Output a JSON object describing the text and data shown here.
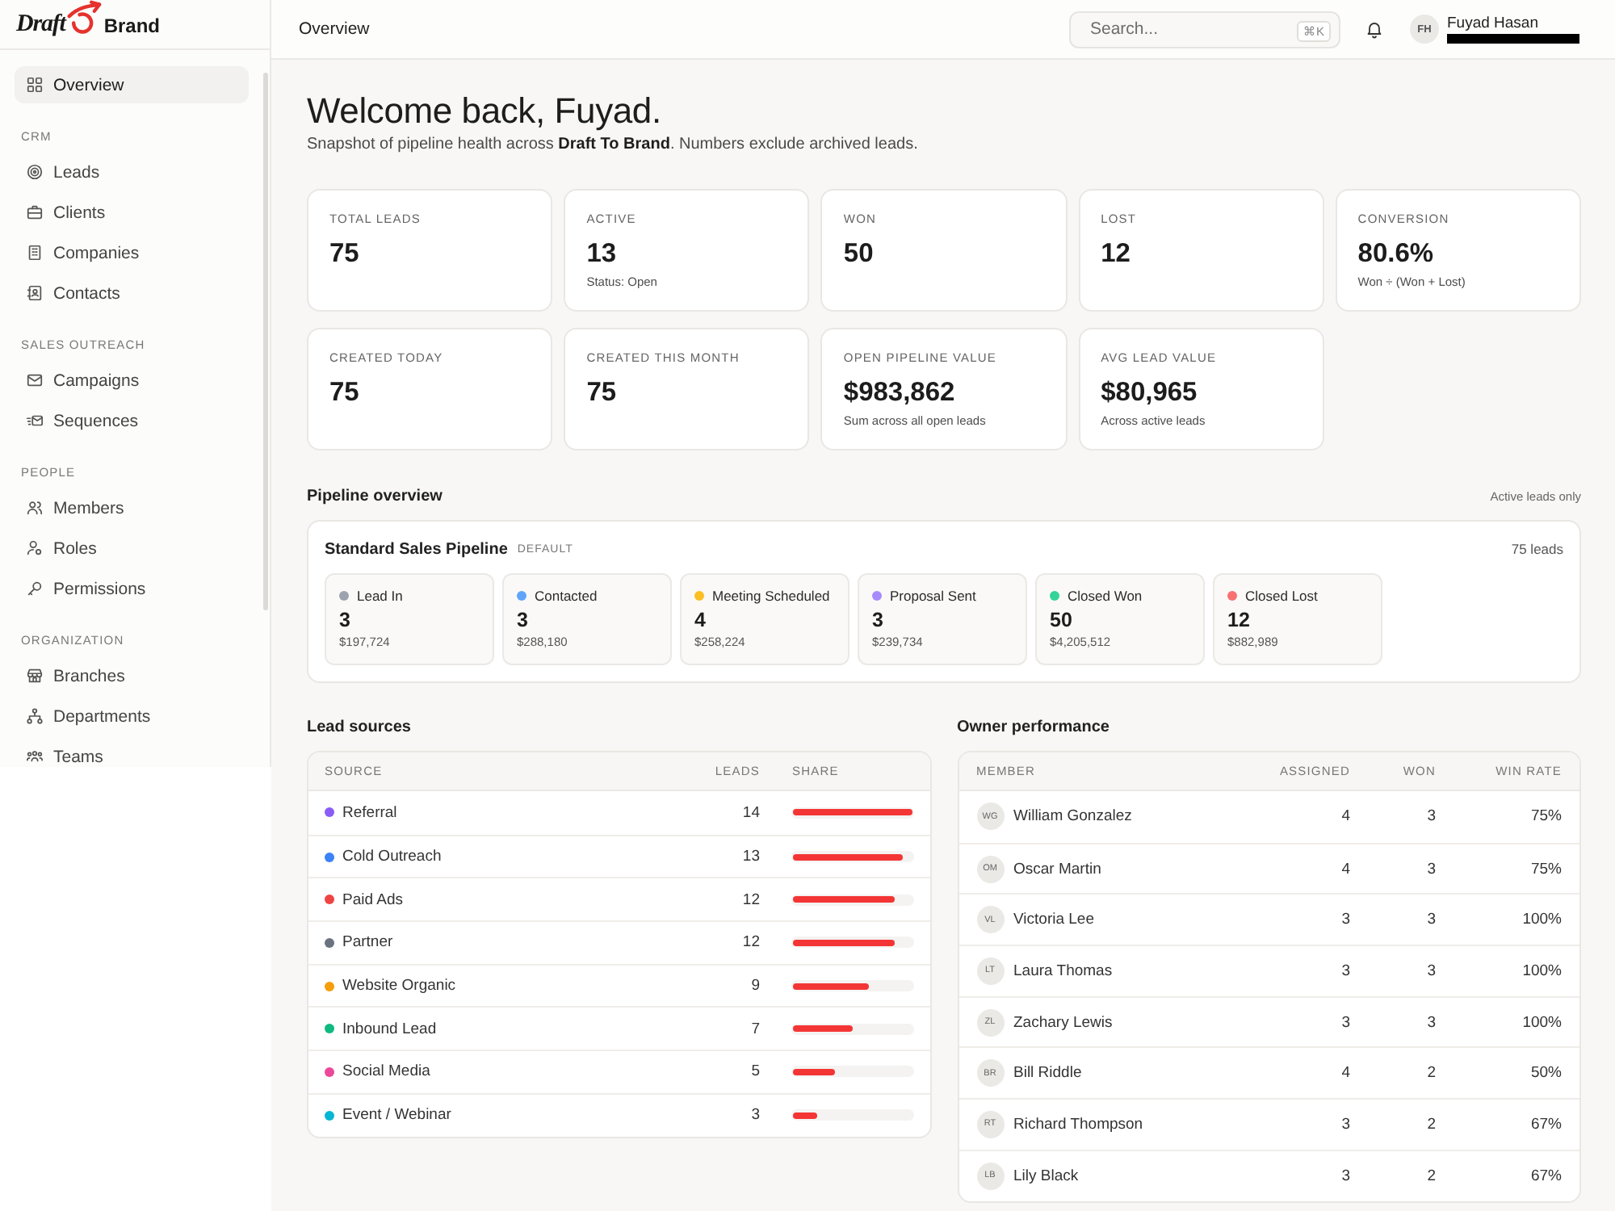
{
  "logo": {
    "word_left": "Draft",
    "word_right": "Brand"
  },
  "sidebar": {
    "sections": [
      {
        "items": [
          {
            "label": "Overview",
            "selected": true
          }
        ]
      },
      {
        "label": "CRM",
        "items": [
          {
            "label": "Leads",
            "selected": false
          },
          {
            "label": "Clients",
            "selected": false
          },
          {
            "label": "Companies",
            "selected": false
          },
          {
            "label": "Contacts",
            "selected": false
          }
        ]
      },
      {
        "label": "SALES OUTREACH",
        "items": [
          {
            "label": "Campaigns",
            "selected": false
          },
          {
            "label": "Sequences",
            "selected": false
          }
        ]
      },
      {
        "label": "PEOPLE",
        "items": [
          {
            "label": "Members",
            "selected": false
          },
          {
            "label": "Roles",
            "selected": false
          },
          {
            "label": "Permissions",
            "selected": false
          }
        ]
      },
      {
        "label": "ORGANIZATION",
        "items": [
          {
            "label": "Branches",
            "selected": false
          },
          {
            "label": "Departments",
            "selected": false
          },
          {
            "label": "Teams",
            "selected": false
          }
        ]
      }
    ]
  },
  "topbar": {
    "title": "Overview",
    "search": {
      "placeholder": "Search...",
      "shortcut": "⌘K"
    },
    "user": {
      "initials": "FH",
      "name": "Fuyad Hasan"
    }
  },
  "welcome": {
    "title": "Welcome back, Fuyad.",
    "subtitle": "Snapshot of pipeline health across **Draft To Brand**. Numbers exclude archived leads."
  },
  "stats": [
    {
      "label": "TOTAL LEADS",
      "value": "75"
    },
    {
      "label": "ACTIVE",
      "value": "13",
      "note": "Status: Open"
    },
    {
      "label": "WON",
      "value": "50"
    },
    {
      "label": "LOST",
      "value": "12"
    },
    {
      "label": "CONVERSION",
      "value": "80.6%",
      "note": "Won ÷ (Won + Lost)"
    },
    {
      "label": "CREATED TODAY",
      "value": "75"
    },
    {
      "label": "CREATED THIS MONTH",
      "value": "75"
    },
    {
      "label": "OPEN PIPELINE VALUE",
      "value": "$983,862",
      "note": "Sum across all open leads"
    },
    {
      "label": "AVG LEAD VALUE",
      "value": "$80,965",
      "note": "Across active leads"
    }
  ],
  "pipeline": {
    "heading": "Pipeline overview",
    "note": "Active leads only",
    "name": "Standard Sales Pipeline",
    "badge": "DEFAULT",
    "total": "75 leads",
    "stages": [
      {
        "name": "Lead In",
        "color": "#9ca3af",
        "count": "3",
        "value": "$197,724"
      },
      {
        "name": "Contacted",
        "color": "#60a5fa",
        "count": "3",
        "value": "$288,180"
      },
      {
        "name": "Meeting Scheduled",
        "color": "#fbbf24",
        "count": "4",
        "value": "$258,224"
      },
      {
        "name": "Proposal Sent",
        "color": "#a78bfa",
        "count": "3",
        "value": "$239,734"
      },
      {
        "name": "Closed Won",
        "color": "#34d399",
        "count": "50",
        "value": "$4,205,512"
      },
      {
        "name": "Closed Lost",
        "color": "#f87171",
        "count": "12",
        "value": "$882,989"
      }
    ]
  },
  "lead_sources": {
    "heading": "Lead sources",
    "columns": [
      "SOURCE",
      "LEADS",
      "SHARE"
    ],
    "rows": [
      {
        "name": "Referral",
        "color": "#8b5cf6",
        "leads": "14",
        "level": 1
      },
      {
        "name": "Cold Outreach",
        "color": "#3b82f6",
        "leads": "13",
        "level": 0.93
      },
      {
        "name": "Paid Ads",
        "color": "#ef4444",
        "leads": "12",
        "level": 0.86
      },
      {
        "name": "Partner",
        "color": "#6b7280",
        "leads": "12",
        "level": 0.86
      },
      {
        "name": "Website Organic",
        "color": "#f59e0b",
        "leads": "9",
        "level": 0.64
      },
      {
        "name": "Inbound Lead",
        "color": "#10b981",
        "leads": "7",
        "level": 0.5
      },
      {
        "name": "Social Media",
        "color": "#ec4899",
        "leads": "5",
        "level": 0.36
      },
      {
        "name": "Event / Webinar",
        "color": "#06b6d4",
        "leads": "3",
        "level": 0.21
      }
    ]
  },
  "owner_performance": {
    "heading": "Owner performance",
    "columns": [
      "MEMBER",
      "ASSIGNED",
      "WON",
      "WIN RATE"
    ],
    "rows": [
      {
        "initials": "WG",
        "name": "William Gonzalez",
        "assigned": "4",
        "won": "3",
        "win_rate": "75%"
      },
      {
        "initials": "OM",
        "name": "Oscar Martin",
        "assigned": "4",
        "won": "3",
        "win_rate": "75%"
      },
      {
        "initials": "VL",
        "name": "Victoria Lee",
        "assigned": "3",
        "won": "3",
        "win_rate": "100%"
      },
      {
        "initials": "LT",
        "name": "Laura Thomas",
        "assigned": "3",
        "won": "3",
        "win_rate": "100%"
      },
      {
        "initials": "ZL",
        "name": "Zachary Lewis",
        "assigned": "3",
        "won": "3",
        "win_rate": "100%"
      },
      {
        "initials": "BR",
        "name": "Bill Riddle",
        "assigned": "4",
        "won": "2",
        "win_rate": "50%"
      },
      {
        "initials": "RT",
        "name": "Richard Thompson",
        "assigned": "3",
        "won": "2",
        "win_rate": "67%"
      },
      {
        "initials": "LB",
        "name": "Lily Black",
        "assigned": "3",
        "won": "2",
        "win_rate": "67%"
      }
    ]
  }
}
